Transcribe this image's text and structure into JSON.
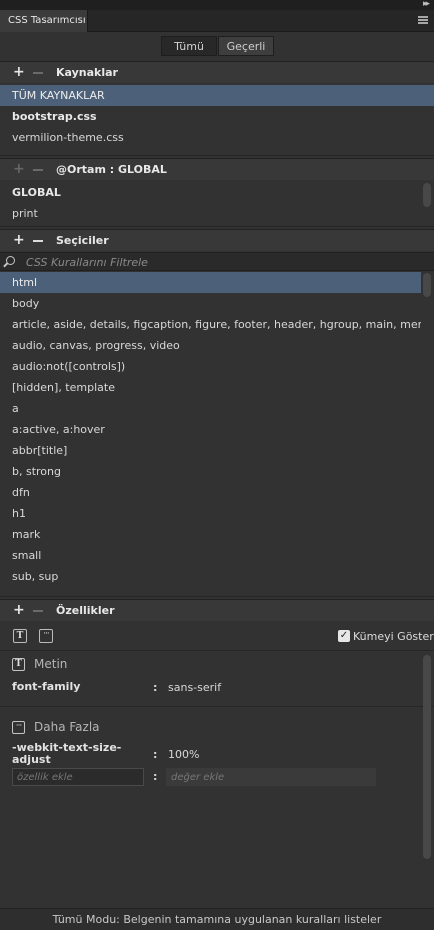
{
  "panel": {
    "tab_title": "CSS Tasarımcısı"
  },
  "mode_toggle": {
    "all_label": "Tümü",
    "current_label": "Geçerli"
  },
  "sources": {
    "title": "Kaynaklar",
    "items": [
      {
        "label": "TÜM KAYNAKLAR"
      },
      {
        "label": "bootstrap.css"
      },
      {
        "label": "vermilion-theme.css"
      }
    ]
  },
  "media": {
    "title": "@Ortam :",
    "current": "GLOBAL",
    "items": [
      {
        "label": "GLOBAL"
      },
      {
        "label": "print"
      }
    ]
  },
  "selectors": {
    "title": "Seçiciler",
    "filter_placeholder": "CSS Kurallarını Filtrele",
    "items": [
      {
        "label": "html"
      },
      {
        "label": "body"
      },
      {
        "label": "article, aside, details, figcaption, figure, footer, header, hgroup, main, menu,..."
      },
      {
        "label": "audio, canvas, progress, video"
      },
      {
        "label": "audio:not([controls])"
      },
      {
        "label": "[hidden], template"
      },
      {
        "label": "a"
      },
      {
        "label": "a:active, a:hover"
      },
      {
        "label": "abbr[title]"
      },
      {
        "label": "b, strong"
      },
      {
        "label": "dfn"
      },
      {
        "label": "h1"
      },
      {
        "label": "mark"
      },
      {
        "label": "small"
      },
      {
        "label": "sub, sup"
      }
    ]
  },
  "properties": {
    "title": "Özellikler",
    "show_set_label": "Kümeyi Göster",
    "show_set_checked": true,
    "text_category": "Metin",
    "more_category": "Daha Fazla",
    "text_props": [
      {
        "name": "font-family",
        "value": "sans-serif"
      }
    ],
    "more_props": [
      {
        "name_line1": "-webkit-text-size-",
        "name_line2": "adjust",
        "value": "100%"
      }
    ],
    "add_property_placeholder": "özellik ekle",
    "add_value_placeholder": "değer ekle"
  },
  "status": {
    "text": "Tümü Modu: Belgenin tamamına uygulanan kuralları listeler"
  }
}
